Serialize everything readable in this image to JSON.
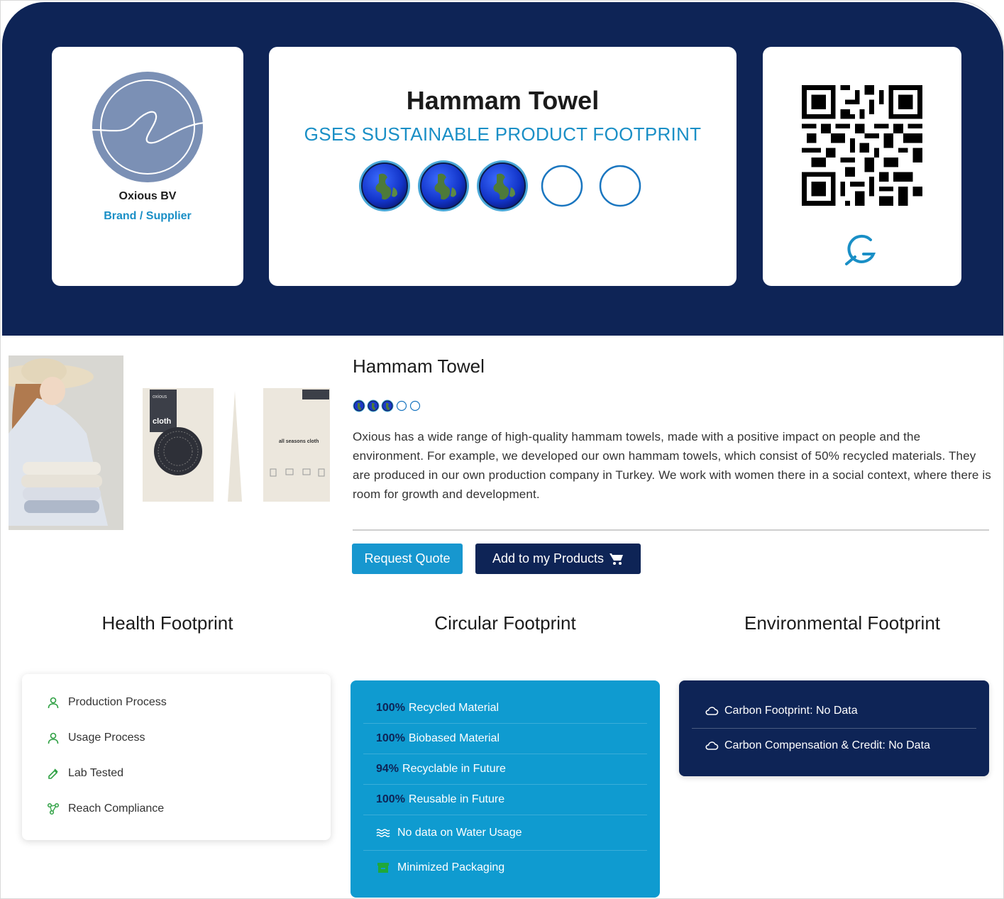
{
  "brand": {
    "name": "Oxious BV",
    "role": "Brand / Supplier"
  },
  "product": {
    "title": "Hammam Towel",
    "subtitle": "GSES SUSTAINABLE PRODUCT FOOTPRINT",
    "rating": {
      "filled": 3,
      "total": 5
    }
  },
  "details": {
    "title": "Hammam Towel",
    "description": "Oxious has a wide range of high-quality hammam towels, made with a positive impact on people and the environment. For example, we developed our own hammam towels, which consist of 50% recycled materials. They are produced in our own production company in Turkey. We work with women there in a social context, where there is room for growth and development.",
    "buttons": {
      "request_quote": "Request Quote",
      "add_products": "Add to my Products"
    }
  },
  "packaging_text": {
    "brand": "oxious",
    "product": "cloth",
    "back": "all seasons cloth"
  },
  "health": {
    "title": "Health Footprint",
    "items": [
      {
        "label": "Production Process",
        "icon": "person-icon"
      },
      {
        "label": "Usage Process",
        "icon": "person-icon"
      },
      {
        "label": "Lab Tested",
        "icon": "pipette-icon"
      },
      {
        "label": "Reach Compliance",
        "icon": "molecule-icon"
      }
    ]
  },
  "circular": {
    "title": "Circular Footprint",
    "items": [
      {
        "pct": "100%",
        "label": "Recycled Material"
      },
      {
        "pct": "100%",
        "label": "Biobased Material"
      },
      {
        "pct": "94%",
        "label": "Recyclable in Future"
      },
      {
        "pct": "100%",
        "label": "Reusable in Future"
      },
      {
        "pct": "",
        "label": "No data on Water Usage",
        "icon": "water-icon"
      },
      {
        "pct": "",
        "label": "Minimized Packaging",
        "icon": "box-icon"
      }
    ]
  },
  "environmental": {
    "title": "Environmental Footprint",
    "items": [
      {
        "label": "Carbon Footprint: No Data",
        "icon": "cloud-icon"
      },
      {
        "label": "Carbon Compensation & Credit: No Data",
        "icon": "cloud-icon"
      }
    ]
  },
  "colors": {
    "navy": "#0e2456",
    "accent_blue": "#1a8fc6",
    "circular_bg": "#0f9bd0",
    "health_green": "#2ea043"
  }
}
